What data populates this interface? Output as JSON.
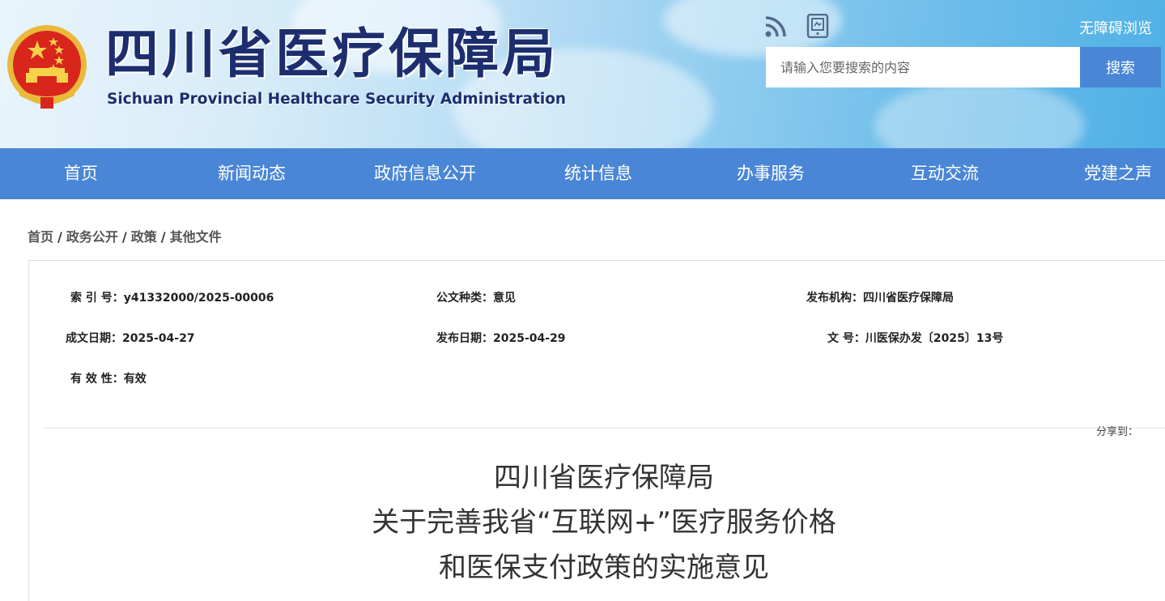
{
  "header": {
    "site_title": "四川省医疗保障局",
    "site_subtitle": "Sichuan Provincial Healthcare Security Administration",
    "accessibility_link": "无障碍浏览",
    "search_placeholder": "请输入您要搜索的内容",
    "search_button": "搜索",
    "icons": [
      "rss-icon",
      "mobile-icon",
      "national-emblem-icon"
    ]
  },
  "nav": {
    "items": [
      "首页",
      "新闻动态",
      "政府信息公开",
      "统计信息",
      "办事服务",
      "互动交流",
      "党建之声"
    ]
  },
  "breadcrumb": [
    "首页",
    "政务公开",
    "政策",
    "其他文件"
  ],
  "breadcrumb_separator": "/",
  "meta": {
    "index_label": "索 引 号：",
    "index_value": "y41332000/2025-00006",
    "type_label": "公文种类：",
    "type_value": "意见",
    "org_label": "发布机构：",
    "org_value": "四川省医疗保障局",
    "created_label": "成文日期：",
    "created_value": "2025-04-27",
    "published_label": "发布日期：",
    "published_value": "2025-04-29",
    "docno_label": "文 号：",
    "docno_value": "川医保办发〔2025〕13号",
    "validity_label": "有 效 性：",
    "validity_value": "有效"
  },
  "share_label": "分享到：",
  "document": {
    "title_line1": "四川省医疗保障局",
    "title_line2": "关于完善我省“互联网+”医疗服务价格",
    "title_line3": "和医保支付政策的实施意见"
  },
  "colors": {
    "nav_bg": "#4a86d6",
    "title_navy": "#1c2e6e",
    "emblem_red": "#d8261d",
    "emblem_gold": "#e9b93a"
  }
}
